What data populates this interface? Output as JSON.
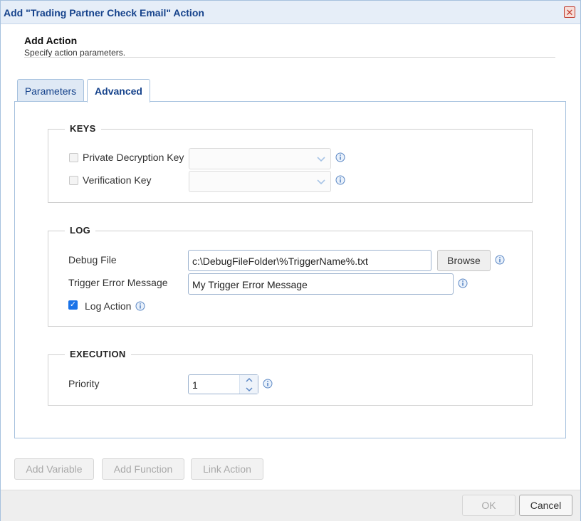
{
  "window": {
    "title": "Add \"Trading Partner Check Email\" Action"
  },
  "header": {
    "title": "Add Action",
    "subtitle": "Specify action parameters."
  },
  "tabs": [
    {
      "label": "Parameters",
      "active": false
    },
    {
      "label": "Advanced",
      "active": true
    }
  ],
  "keys": {
    "legend": "KEYS",
    "private_decryption_key": {
      "label": "Private Decryption Key",
      "checked": false,
      "value": ""
    },
    "verification_key": {
      "label": "Verification Key",
      "checked": false,
      "value": ""
    }
  },
  "log": {
    "legend": "LOG",
    "debug_file": {
      "label": "Debug File",
      "value": "c:\\DebugFileFolder\\%TriggerName%.txt",
      "browse_label": "Browse"
    },
    "trigger_error_message": {
      "label": "Trigger Error Message",
      "value": "My Trigger Error Message"
    },
    "log_action": {
      "label": "Log Action",
      "checked": true
    }
  },
  "execution": {
    "legend": "EXECUTION",
    "priority": {
      "label": "Priority",
      "value": "1"
    }
  },
  "bottom_buttons": {
    "add_variable": "Add Variable",
    "add_function": "Add Function",
    "link_action": "Link Action"
  },
  "footer": {
    "ok": "OK",
    "cancel": "Cancel"
  },
  "colors": {
    "title": "#15428b",
    "border": "#a6c1de",
    "accent": "#1a73e8",
    "info": "#5b87c4"
  },
  "icons": {
    "close": "close-icon",
    "info": "info-icon",
    "dropdown": "chevron-down-icon",
    "check": "checkmark-icon"
  }
}
